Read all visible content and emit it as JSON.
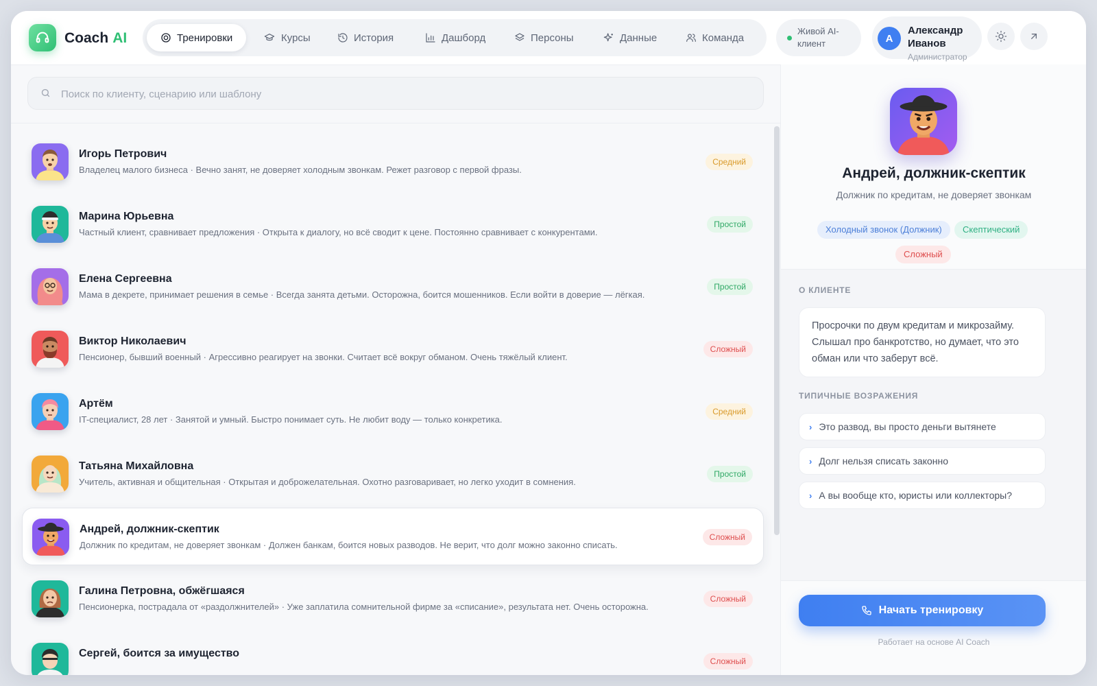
{
  "header": {
    "brand_name": "Coach",
    "brand_suffix": "AI",
    "nav": [
      {
        "label": "Тренировки",
        "icon": "target-icon",
        "active": true
      },
      {
        "label": "Курсы",
        "icon": "graduation-cap-icon",
        "active": false
      },
      {
        "label": "История",
        "icon": "history-icon",
        "active": false
      },
      {
        "label": "Дашборд",
        "icon": "bar-chart-icon",
        "active": false
      },
      {
        "label": "Персоны",
        "icon": "layers-icon",
        "active": false
      },
      {
        "label": "Данные",
        "icon": "sparkle-icon",
        "active": false
      },
      {
        "label": "Команда",
        "icon": "users-icon",
        "active": false
      }
    ],
    "live_status": "Живой AI-клиент",
    "user": {
      "initial": "А",
      "name": "Александр Иванов",
      "role": "Администратор"
    }
  },
  "search": {
    "placeholder": "Поиск по клиенту, сценарию или шаблону",
    "value": ""
  },
  "clients": [
    {
      "name": "Игорь Петрович",
      "description": "Владелец малого бизнеса · Вечно занят, не доверяет холодным звонкам. Режет разговор с первой фразы.",
      "difficulty": "Средний",
      "level": "mid"
    },
    {
      "name": "Марина Юрьевна",
      "description": "Частный клиент, сравнивает предложения · Открыта к диалогу, но всё сводит к цене. Постоянно сравнивает с конкурентами.",
      "difficulty": "Простой",
      "level": "easy"
    },
    {
      "name": "Елена Сергеевна",
      "description": "Мама в декрете, принимает решения в семье · Всегда занята детьми. Осторожна, боится мошенников. Если войти в доверие — лёгкая.",
      "difficulty": "Простой",
      "level": "easy"
    },
    {
      "name": "Виктор Николаевич",
      "description": "Пенсионер, бывший военный · Агрессивно реагирует на звонки. Считает всё вокруг обманом. Очень тяжёлый клиент.",
      "difficulty": "Сложный",
      "level": "hard"
    },
    {
      "name": "Артём",
      "description": "IT-специалист, 28 лет · Занятой и умный. Быстро понимает суть. Не любит воду — только конкретика.",
      "difficulty": "Средний",
      "level": "mid"
    },
    {
      "name": "Татьяна Михайловна",
      "description": "Учитель, активная и общительная · Открытая и доброжелательная. Охотно разговаривает, но легко уходит в сомнения.",
      "difficulty": "Простой",
      "level": "easy"
    },
    {
      "name": "Андрей, должник-скептик",
      "description": "Должник по кредитам, не доверяет звонкам · Должен банкам, боится новых разводов. Не верит, что долг можно законно списать.",
      "difficulty": "Сложный",
      "level": "hard",
      "selected": true
    },
    {
      "name": "Галина Петровна, обжёгшаяся",
      "description": "Пенсионерка, пострадала от «раздолжнителей» · Уже заплатила сомнительной фирме за «списание», результата нет. Очень осторожна.",
      "difficulty": "Сложный",
      "level": "hard"
    },
    {
      "name": "Сергей, боится за имущество",
      "description": "",
      "difficulty": "Сложный",
      "level": "hard"
    }
  ],
  "detail": {
    "name": "Андрей, должник-скептик",
    "subtitle": "Должник по кредитам, не доверяет звонкам",
    "tags": [
      "Холодный звонок (Должник)",
      "Скептический",
      "Сложный"
    ],
    "about_label": "О КЛИЕНТЕ",
    "about_text": "Просрочки по двум кредитам и микрозайму. Слышал про банкротство, но думает, что это обман или что заберут всё.",
    "objections_label": "ТИПИЧНЫЕ ВОЗРАЖЕНИЯ",
    "objections": [
      "Это развод, вы просто деньги вытянете",
      "Долг нельзя списать законно",
      "А вы вообще кто, юристы или коллекторы?"
    ],
    "start_label": "Начать тренировку",
    "powered_by": "Работает на основе AI Coach"
  },
  "colors": {
    "accent": "#3f7ff1",
    "brand": "#2fbf74",
    "easy": "#2fa865",
    "mid": "#d99a2b",
    "hard": "#de4e4e"
  }
}
